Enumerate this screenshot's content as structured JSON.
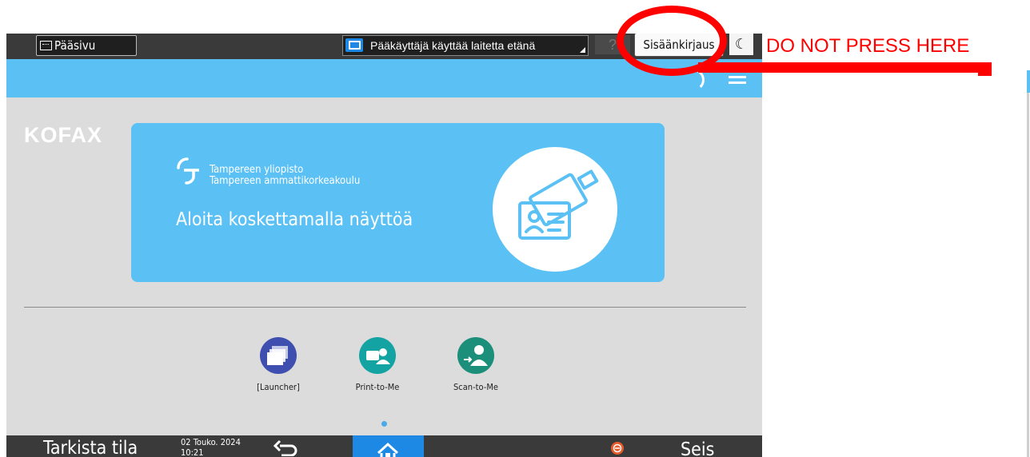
{
  "topbar": {
    "home_label": "Pääsivu",
    "remote_status": "Pääkäyttäjä käyttää laitetta etänä",
    "help_label": "?",
    "login_label": "Sisäänkirjaus",
    "moon_icon": "moon-icon"
  },
  "header": {
    "menu_icon": "hamburger-menu-icon"
  },
  "brand": {
    "logo_text": "KOFAX"
  },
  "banner": {
    "institution_line1": "Tampereen yliopisto",
    "institution_line2": "Tampereen ammattikorkeakoulu",
    "prompt": "Aloita koskettamalla näyttöä",
    "icon": "id-card-hand-icon",
    "color": "#5bc1f5"
  },
  "apps": [
    {
      "label": "[Launcher]",
      "icon": "launcher-icon",
      "color": "#3f4faf"
    },
    {
      "label": "Print-to-Me",
      "icon": "print-to-me-icon",
      "color": "#14a3a3"
    },
    {
      "label": "Scan-to-Me",
      "icon": "scan-to-me-icon",
      "color": "#1c8f7a"
    }
  ],
  "bottombar": {
    "check_status": "Tarkista tila",
    "date": "02 Touko. 2024",
    "time": "10:21",
    "stop_label": "Seis"
  },
  "overlay": {
    "warning": "DO NOT PRESS HERE",
    "color": "#ff0000"
  }
}
